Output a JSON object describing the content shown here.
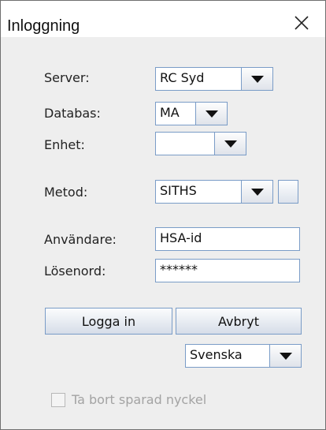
{
  "window": {
    "title": "Inloggning",
    "close_symbol": "close-icon"
  },
  "form": {
    "server": {
      "label": "Server:",
      "value": "RC Syd"
    },
    "database": {
      "label": "Databas:",
      "value": "MA"
    },
    "unit": {
      "label": "Enhet:",
      "value": ""
    },
    "method": {
      "label": "Metod:",
      "value": "SITHS"
    },
    "user": {
      "label": "Användare:",
      "value": "HSA-id"
    },
    "password": {
      "label": "Lösenord:",
      "value": "******"
    }
  },
  "buttons": {
    "login": "Logga in",
    "cancel": "Avbryt"
  },
  "language": {
    "value": "Svenska"
  },
  "remove_saved_key": {
    "label": "Ta bort sparad nyckel",
    "checked": false,
    "enabled": false
  },
  "colors": {
    "border_accent": "#7a9cc7",
    "panel_bg": "#eeeeee",
    "disabled_text": "#a3a3a3"
  }
}
